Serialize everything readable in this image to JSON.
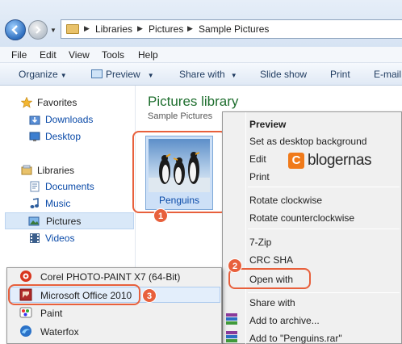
{
  "address": {
    "crumbs": [
      "Libraries",
      "Pictures",
      "Sample Pictures"
    ]
  },
  "menubar": [
    "File",
    "Edit",
    "View",
    "Tools",
    "Help"
  ],
  "toolbar": {
    "organize": "Organize",
    "preview": "Preview",
    "share_with": "Share with",
    "slide_show": "Slide show",
    "print": "Print",
    "email": "E-mail"
  },
  "nav": {
    "favorites": "Favorites",
    "downloads": "Downloads",
    "desktop": "Desktop",
    "libraries": "Libraries",
    "documents": "Documents",
    "music": "Music",
    "pictures": "Pictures",
    "videos": "Videos"
  },
  "content": {
    "title": "Pictures library",
    "subtitle": "Sample Pictures",
    "file_name": "Penguins"
  },
  "context_menu": {
    "preview": "Preview",
    "set_desktop_bg": "Set as desktop background",
    "edit": "Edit",
    "print": "Print",
    "rotate_cw": "Rotate clockwise",
    "rotate_ccw": "Rotate counterclockwise",
    "seven_zip": "7-Zip",
    "crc_sha": "CRC SHA",
    "open_with": "Open with",
    "share_with": "Share with",
    "add_archive": "Add to archive...",
    "add_rar": "Add to \"Penguins.rar\""
  },
  "open_with_submenu": {
    "corel": "Corel PHOTO-PAINT X7 (64-Bit)",
    "office": "Microsoft Office 2010",
    "paint": "Paint",
    "waterfox": "Waterfox"
  },
  "callouts": {
    "one": "1",
    "two": "2",
    "three": "3"
  },
  "watermark": {
    "logo_letter": "C",
    "text": "blogernas"
  },
  "colors": {
    "callout": "#e8603c",
    "library_title": "#1e6e2e",
    "link": "#0a4aa8"
  }
}
